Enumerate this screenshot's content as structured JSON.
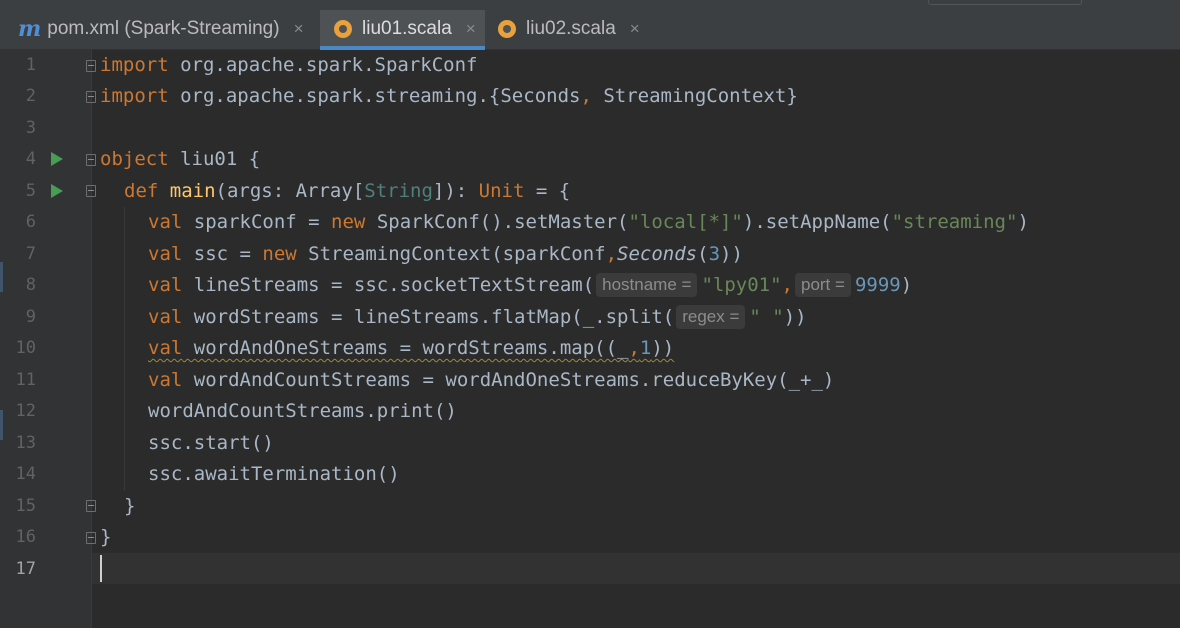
{
  "tabs": [
    {
      "label": "pom.xml (Spark-Streaming)",
      "icon": "maven-icon",
      "active": false
    },
    {
      "label": "liu01.scala",
      "icon": "scala-file-icon",
      "active": true
    },
    {
      "label": "liu02.scala",
      "icon": "scala-file-icon",
      "active": false
    }
  ],
  "tab_close_glyph": "×",
  "maven_glyph": "m",
  "line_numbers": [
    "1",
    "2",
    "3",
    "4",
    "5",
    "6",
    "7",
    "8",
    "9",
    "10",
    "11",
    "12",
    "13",
    "14",
    "15",
    "16",
    "17"
  ],
  "current_line": "17",
  "run_markers_lines": [
    "4",
    "5"
  ],
  "code": {
    "l1": {
      "kw": "import",
      "rest": " org.apache.spark.SparkConf"
    },
    "l2": {
      "kw": "import",
      "rest": " org.apache.spark.streaming.{Seconds",
      "comma": ",",
      "rest2": " StreamingContext}"
    },
    "l4": {
      "kw": "object",
      "rest": " liu01 {"
    },
    "l5": {
      "kw": "def",
      "fn": "main",
      "a": "(args: Array[",
      "typ": "String",
      "b": "]): ",
      "kw2": "Unit",
      "c": " = {"
    },
    "l6": {
      "kw": "val",
      "a": " sparkConf = ",
      "kw2": "new",
      "b": " SparkConf().setMaster(",
      "s1": "\"local[*]\"",
      "c": ").setAppName(",
      "s2": "\"streaming\"",
      "d": ")"
    },
    "l7": {
      "kw": "val",
      "a": " ssc = ",
      "kw2": "new",
      "b": " StreamingContext(sparkConf",
      "comma": ",",
      "it": "Seconds",
      "c": "(",
      "n": "3",
      "d": "))"
    },
    "l8": {
      "kw": "val",
      "a": " lineStreams = ssc.socketTextStream(",
      "h1": "hostname =",
      "s1": "\"lpy01\"",
      "comma": ",",
      "h2": "port =",
      "n": "9999",
      "d": ")"
    },
    "l9": {
      "kw": "val",
      "a": " wordStreams = lineStreams.flatMap(_.split(",
      "h1": "regex =",
      "s1": "\" \"",
      "d": "))"
    },
    "l10": {
      "kw": "val",
      "a": " wordAndOneStreams = wordStreams.map((_",
      "comma": ",",
      "n": "1",
      "d": "))"
    },
    "l11": {
      "kw": "val",
      "a": " wordAndCountStreams = wordAndOneStreams.reduceByKey(_+_)"
    },
    "l12": {
      "a": "wordAndCountStreams.print()"
    },
    "l13": {
      "a": "ssc.start()"
    },
    "l14": {
      "a": "ssc.awaitTermination()"
    },
    "l15": {
      "a": "}"
    },
    "l16": {
      "a": "}"
    }
  },
  "colors": {
    "background": "#2b2b2b",
    "keyword": "#cc7832",
    "string": "#6a8759",
    "number": "#6897bb",
    "function": "#ffc66d",
    "type": "#4e807d",
    "text": "#a9b7c6",
    "active_tab_underline": "#4a88c7",
    "run_icon": "#499c54"
  }
}
